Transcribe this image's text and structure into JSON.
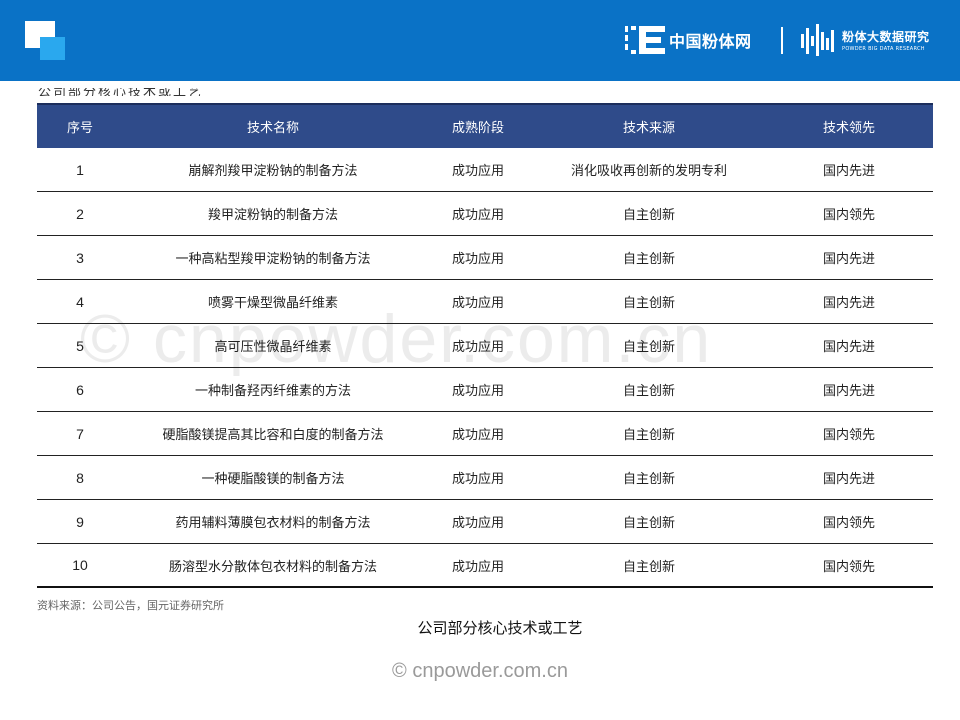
{
  "header": {
    "brand1_name": "中国粉体网",
    "brand2_cn": "粉体大数据研究",
    "brand2_en": "POWDER BIG DATA RESEARCH",
    "accent": "#0a72c6"
  },
  "table": {
    "columns": [
      "序号",
      "技术名称",
      "成熟阶段",
      "技术来源",
      "技术领先"
    ],
    "rows": [
      [
        "1",
        "崩解剂羧甲淀粉钠的制备方法",
        "成功应用",
        "消化吸收再创新的发明专利",
        "国内先进"
      ],
      [
        "2",
        "羧甲淀粉钠的制备方法",
        "成功应用",
        "自主创新",
        "国内领先"
      ],
      [
        "3",
        "一种高粘型羧甲淀粉钠的制备方法",
        "成功应用",
        "自主创新",
        "国内先进"
      ],
      [
        "4",
        "喷雾干燥型微晶纤维素",
        "成功应用",
        "自主创新",
        "国内先进"
      ],
      [
        "5",
        "高可压性微晶纤维素",
        "成功应用",
        "自主创新",
        "国内先进"
      ],
      [
        "6",
        "一种制备羟丙纤维素的方法",
        "成功应用",
        "自主创新",
        "国内先进"
      ],
      [
        "7",
        "硬脂酸镁提高其比容和白度的制备方法",
        "成功应用",
        "自主创新",
        "国内领先"
      ],
      [
        "8",
        "一种硬脂酸镁的制备方法",
        "成功应用",
        "自主创新",
        "国内先进"
      ],
      [
        "9",
        "药用辅料薄膜包衣材料的制备方法",
        "成功应用",
        "自主创新",
        "国内领先"
      ],
      [
        "10",
        "肠溶型水分散体包衣材料的制备方法",
        "成功应用",
        "自主创新",
        "国内领先"
      ]
    ]
  },
  "source": "资料来源：公司公告，国元证券研究所",
  "caption": "公司部分核心技术或工艺",
  "watermark": "© cnpowder.com.cn"
}
